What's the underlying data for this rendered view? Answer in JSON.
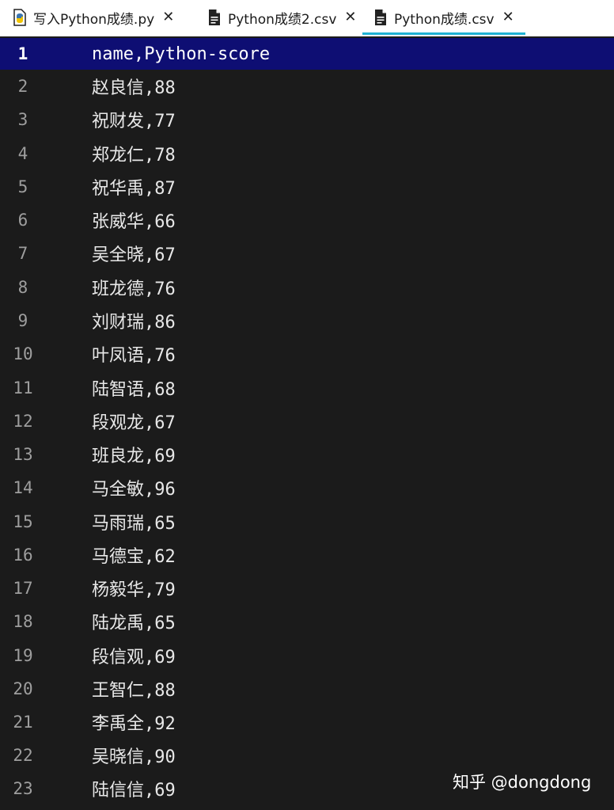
{
  "tabs": [
    {
      "label": "写入Python成绩.py",
      "icon": "python-file-icon",
      "close": "✕",
      "active": false
    },
    {
      "label": "Python成绩2.csv",
      "icon": "document-file-icon",
      "close": "✕",
      "active": false
    },
    {
      "label": "Python成绩.csv",
      "icon": "document-file-icon",
      "close": "✕",
      "active": true
    }
  ],
  "editor": {
    "current_line": 1,
    "lines": [
      {
        "num": "1",
        "text": "name,Python-score"
      },
      {
        "num": "2",
        "text": "赵良信,88"
      },
      {
        "num": "3",
        "text": "祝财发,77"
      },
      {
        "num": "4",
        "text": "郑龙仁,78"
      },
      {
        "num": "5",
        "text": "祝华禹,87"
      },
      {
        "num": "6",
        "text": "张威华,66"
      },
      {
        "num": "7",
        "text": "吴全晓,67"
      },
      {
        "num": "8",
        "text": "班龙德,76"
      },
      {
        "num": "9",
        "text": "刘财瑞,86"
      },
      {
        "num": "10",
        "text": "叶凤语,76"
      },
      {
        "num": "11",
        "text": "陆智语,68"
      },
      {
        "num": "12",
        "text": "段观龙,67"
      },
      {
        "num": "13",
        "text": "班良龙,69"
      },
      {
        "num": "14",
        "text": "马全敏,96"
      },
      {
        "num": "15",
        "text": "马雨瑞,65"
      },
      {
        "num": "16",
        "text": "马德宝,62"
      },
      {
        "num": "17",
        "text": "杨毅华,79"
      },
      {
        "num": "18",
        "text": "陆龙禹,65"
      },
      {
        "num": "19",
        "text": "段信观,69"
      },
      {
        "num": "20",
        "text": "王智仁,88"
      },
      {
        "num": "21",
        "text": "李禹全,92"
      },
      {
        "num": "22",
        "text": "吴晓信,90"
      },
      {
        "num": "23",
        "text": "陆信信,69"
      }
    ]
  },
  "watermark": "知乎 @dongdong",
  "colors": {
    "tab_active_underline": "#1fb2d3",
    "current_line_bg": "#0e0e73",
    "editor_bg": "#1b1b1b"
  }
}
